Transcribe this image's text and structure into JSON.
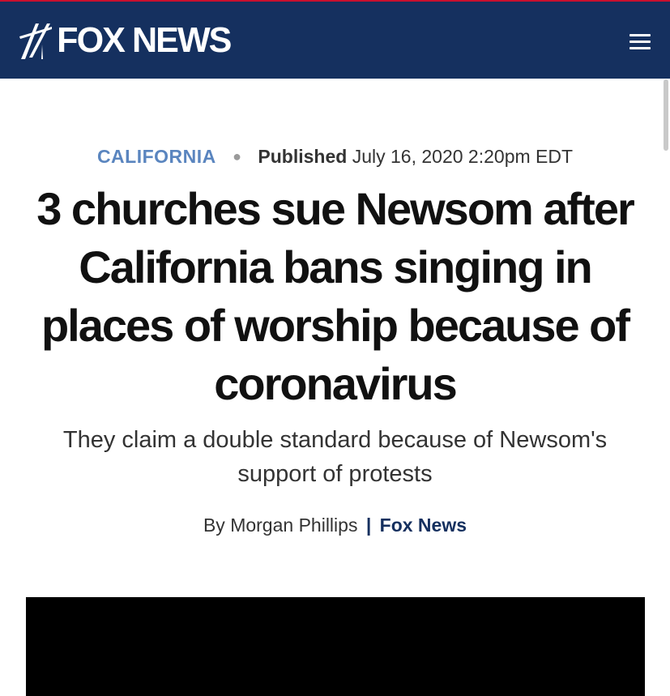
{
  "header": {
    "logo_text": "FOX NEWS",
    "brand_color": "#15305f",
    "menu_icon": "hamburger-menu-icon"
  },
  "article": {
    "category": "CALIFORNIA",
    "published_label": "Published",
    "published_date": "July 16, 2020 2:20pm EDT",
    "headline": "3 churches sue Newsom after California bans singing in places of worship because of coronavirus",
    "subheadline": "They claim a double standard because of Newsom's support of protests",
    "byline_prefix": "By Morgan Phillips",
    "byline_separator": "|",
    "byline_source": "Fox News"
  }
}
